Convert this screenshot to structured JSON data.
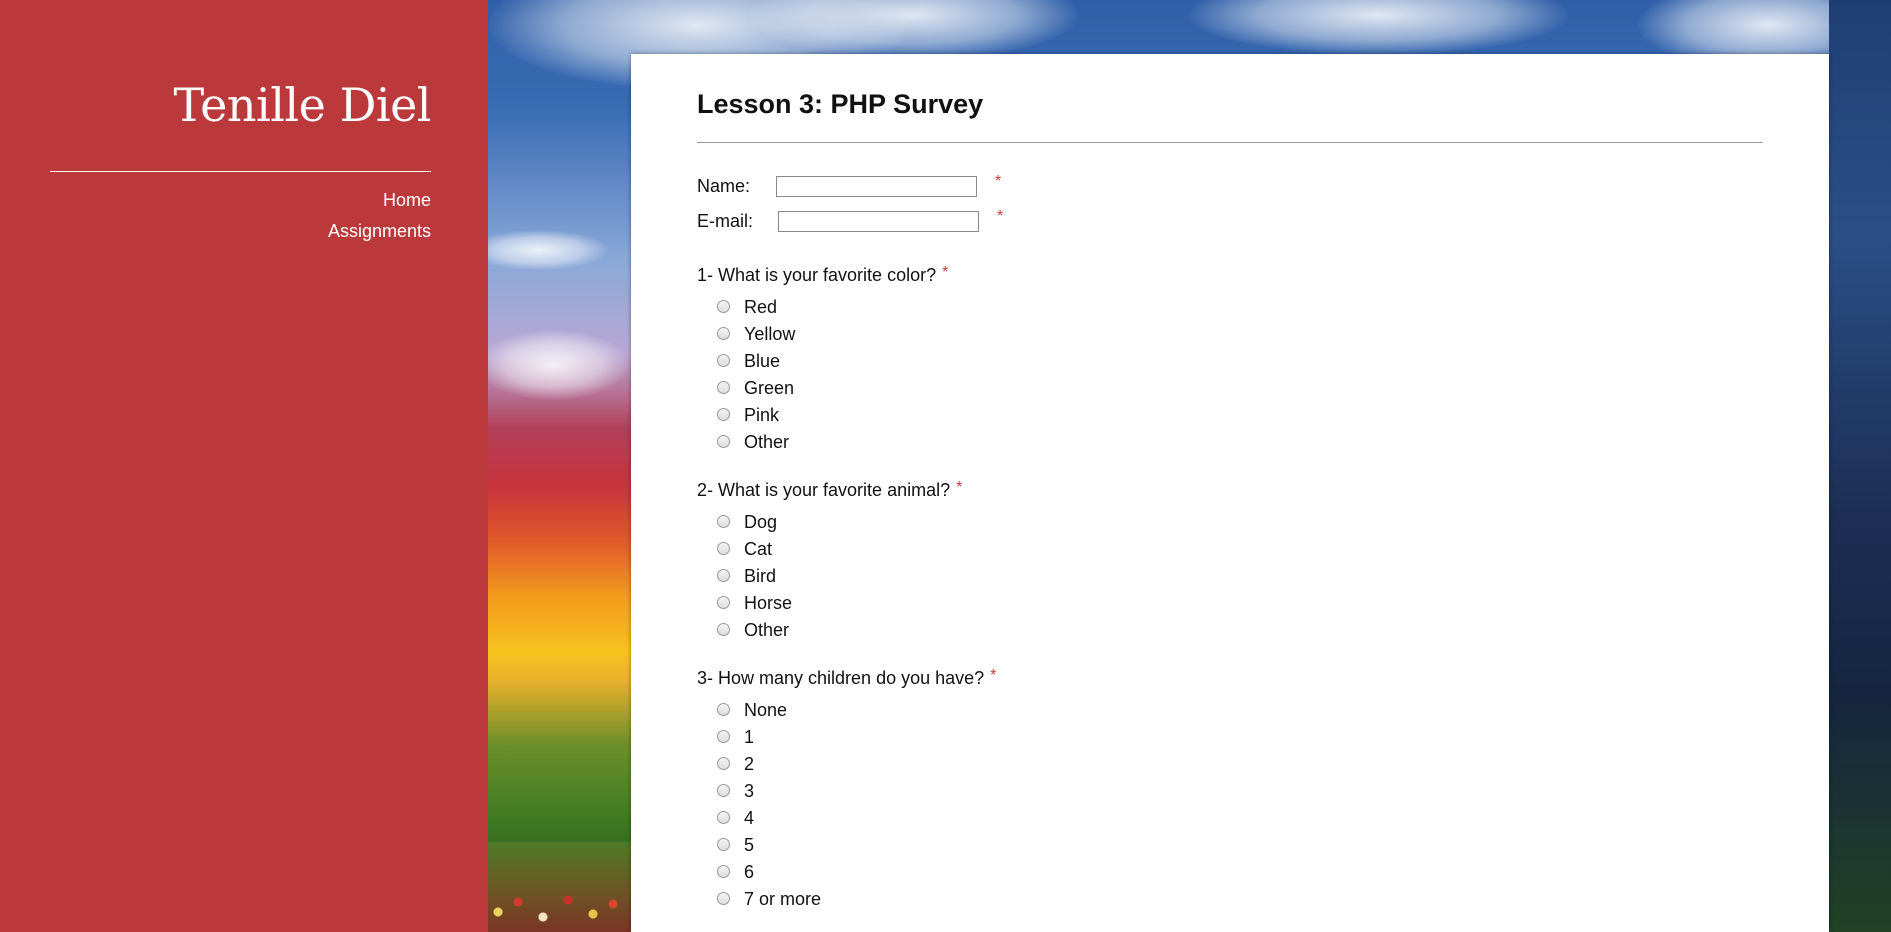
{
  "sidebar": {
    "site_title": "Tenille Diel",
    "nav": [
      {
        "label": "Home"
      },
      {
        "label": "Assignments"
      }
    ]
  },
  "main": {
    "title": "Lesson 3: PHP Survey",
    "required_marker": "*",
    "fields": {
      "name": {
        "label": "Name:",
        "value": ""
      },
      "email": {
        "label": "E-mail:",
        "value": ""
      }
    },
    "questions": [
      {
        "label": "1- What is your favorite color?",
        "options": [
          "Red",
          "Yellow",
          "Blue",
          "Green",
          "Pink",
          "Other"
        ]
      },
      {
        "label": "2- What is your favorite animal?",
        "options": [
          "Dog",
          "Cat",
          "Bird",
          "Horse",
          "Other"
        ]
      },
      {
        "label": "3- How many children do you have?",
        "options": [
          "None",
          "1",
          "2",
          "3",
          "4",
          "5",
          "6",
          "7 or more"
        ]
      }
    ]
  },
  "colors": {
    "sidebar_bg": "#bc393b",
    "required": "#d23b3b"
  }
}
